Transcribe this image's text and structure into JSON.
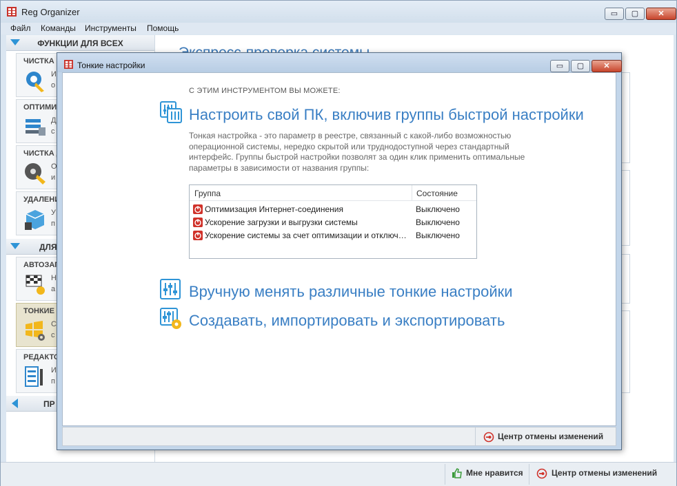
{
  "app": {
    "title": "Reg Organizer"
  },
  "window_buttons": {
    "minimize": "▭",
    "maximize": "▢",
    "close": "✕"
  },
  "menu": [
    "Файл",
    "Команды",
    "Инструменты",
    "Помощь"
  ],
  "sidebar": {
    "section1": "ФУНКЦИИ ДЛЯ ВСЕХ",
    "cards1": [
      {
        "title": "ЧИСТКА Р",
        "d1": "И",
        "d2": "о"
      },
      {
        "title": "ОПТИМИЗ",
        "d1": "Д",
        "d2": "с"
      },
      {
        "title": "ЧИСТКА Д",
        "d1": "О",
        "d2": "и"
      },
      {
        "title": "УДАЛЕНИ",
        "d1": "У",
        "d2": "п"
      }
    ],
    "section2": "ДЛЯ",
    "cards2": [
      {
        "title": "АВТОЗАП",
        "d1": "Н",
        "d2": "а"
      },
      {
        "title": "ТОНКИЕ Н",
        "d1": "С",
        "d2": "с"
      },
      {
        "title": "РЕДАКТО",
        "d1": "И",
        "d2": "п"
      }
    ],
    "section3": "ПР"
  },
  "background": {
    "title": "Экспресс-проверка системы"
  },
  "statusbar": {
    "like": "Мне нравится",
    "undo": "Центр отмены изменений"
  },
  "dialog": {
    "title": "Тонкие настройки",
    "can_label": "С ЭТИМ ИНСТРУМЕНТОМ ВЫ МОЖЕТЕ:",
    "link1": "Настроить свой ПК, включив группы быстрой настройки",
    "description": "Тонкая настройка - это параметр в реестре, связанный с какой-либо возможностью операционной системы, нередко скрытой или труднодоступной через стандартный интерфейс. Группы быстрой настройки позволят за один клик применить оптимальные параметры в зависимости от названия группы:",
    "table": {
      "col_group": "Группа",
      "col_state": "Состояние",
      "rows": [
        {
          "name": "Оптимизация Интернет-соединения",
          "state": "Выключено"
        },
        {
          "name": "Ускорение загрузки и выгрузки системы",
          "state": "Выключено"
        },
        {
          "name": "Ускорение системы за счет оптимизации и отключения ненужных функций",
          "state": "Выключено"
        }
      ]
    },
    "link2": "Вручную менять различные тонкие настройки",
    "link3": "Создавать, импортировать и экспортировать",
    "footer_undo": "Центр отмены изменений"
  },
  "colors": {
    "accent": "#3a7fc4",
    "icon_blue": "#2e94d6",
    "warn_red": "#d0322a"
  }
}
